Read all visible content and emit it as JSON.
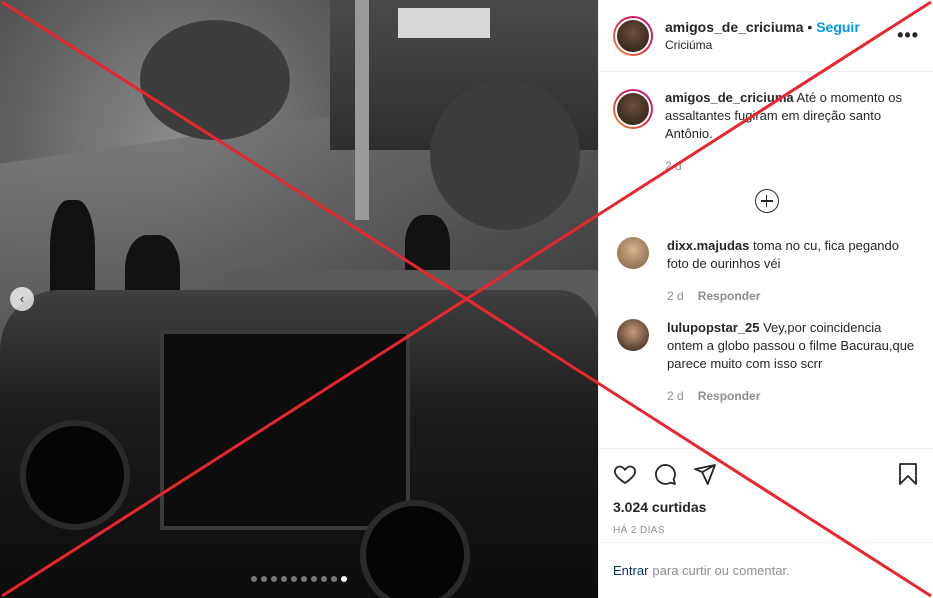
{
  "header": {
    "username": "amigos_de_criciuma",
    "separator": "•",
    "follow_label": "Seguir",
    "location": "Criciúma",
    "more_label": "•••"
  },
  "caption": {
    "username": "amigos_de_criciuma",
    "text": "Até o momento os assaltantes fugiram em direção santo Antônio.",
    "time": "2 d"
  },
  "comments": [
    {
      "username": "dixx.majudas",
      "text": "toma no cu, fica pegando foto de ourinhos véi",
      "time": "2 d",
      "reply_label": "Responder"
    },
    {
      "username": "lulupopstar_25",
      "text": "Vey,por coincidencia ontem a globo passou o filme Bacurau,que parece muito com isso scrr",
      "time": "2 d",
      "reply_label": "Responder"
    }
  ],
  "carousel": {
    "prev_label": "‹",
    "total": 10,
    "active_index": 9
  },
  "engagement": {
    "likes": "3.024 curtidas",
    "posted": "HÁ 2 DIAS"
  },
  "login": {
    "enter_label": "Entrar",
    "rest": "para curtir ou comentar."
  },
  "icons": {
    "heart": "heart-icon",
    "comment": "comment-icon",
    "share": "share-icon",
    "save": "bookmark-icon",
    "plus": "plus-circle-icon",
    "chevron": "chevron-left-icon"
  },
  "colors": {
    "accent": "#0095f6",
    "cross": "#e8262f",
    "muted": "#8e8e8e"
  }
}
